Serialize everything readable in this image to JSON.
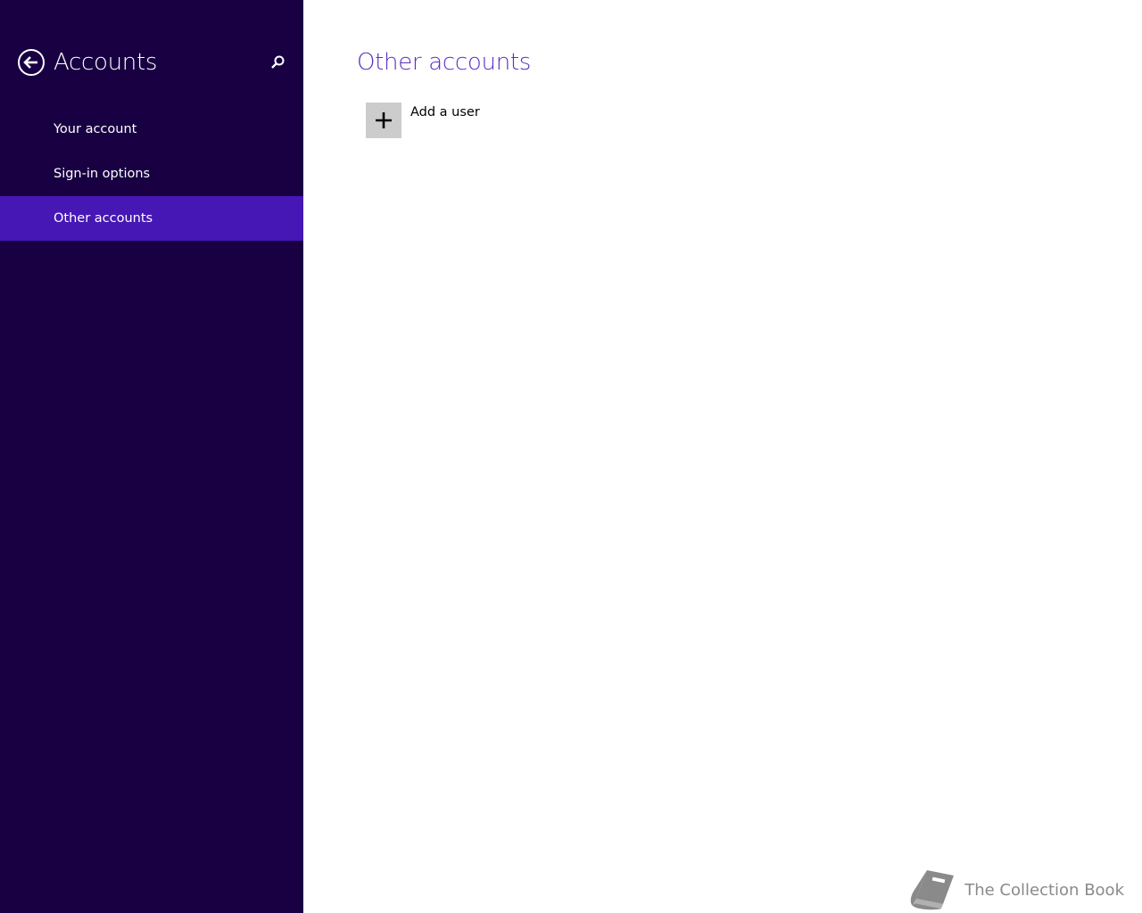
{
  "sidebar": {
    "title": "Accounts",
    "back_icon": "back-arrow-circle-icon",
    "search_icon": "search-icon",
    "items": [
      {
        "label": "Your account",
        "selected": false
      },
      {
        "label": "Sign-in options",
        "selected": false
      },
      {
        "label": "Other accounts",
        "selected": true
      }
    ]
  },
  "main": {
    "title": "Other accounts",
    "add_user": {
      "label": "Add a user",
      "icon": "plus-icon"
    }
  },
  "watermark": {
    "text": "The Collection Book",
    "icon": "book-icon"
  },
  "colors": {
    "sidebar_bg": "#180042",
    "selected_bg": "#4617b4",
    "title_accent": "#5a2fc2",
    "tile_bg": "#cccccc",
    "watermark": "#8a8a8a"
  }
}
